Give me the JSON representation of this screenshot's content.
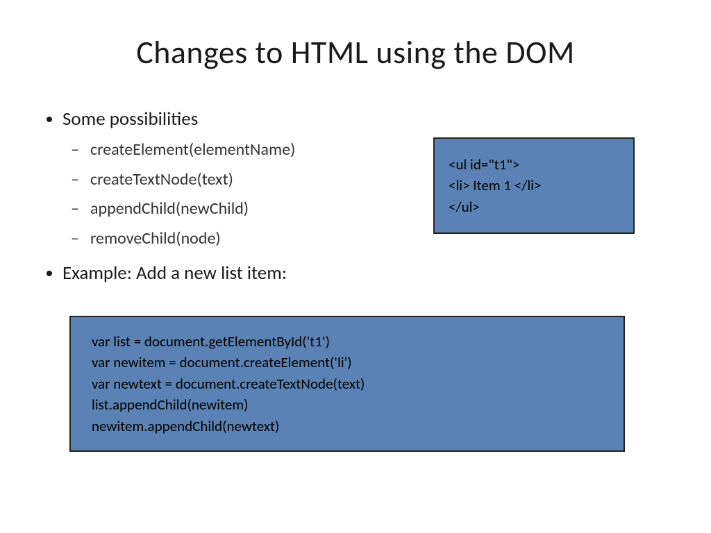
{
  "title": "Changes to HTML using the DOM",
  "bullets": {
    "heading1": "Some possibilities",
    "sub": [
      "createElement(elementName)",
      "createTextNode(text)",
      "appendChild(newChild)",
      "removeChild(node)"
    ],
    "heading2": "Example: Add a new list item:"
  },
  "html_box": [
    "<ul id=\"t1\">",
    "<li> Item 1 </li>",
    "</ul>"
  ],
  "code_box": [
    "var list = document.getElementById('t1')",
    "var newitem = document.createElement('li')",
    "var newtext = document.createTextNode(text)",
    "list.appendChild(newitem)",
    "newitem.appendChild(newtext)"
  ]
}
